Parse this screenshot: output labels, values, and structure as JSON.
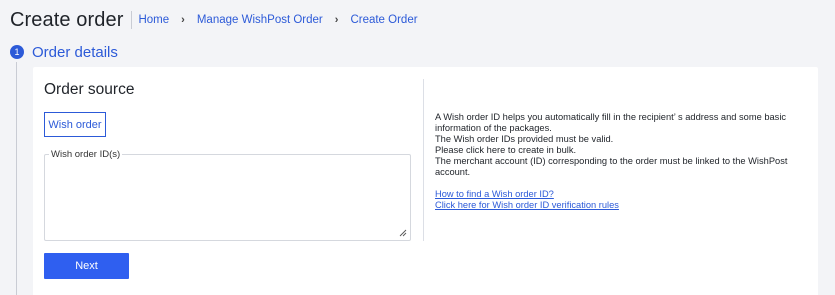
{
  "header": {
    "title": "Create order",
    "breadcrumbs": [
      "Home",
      "Manage WishPost Order",
      "Create Order"
    ]
  },
  "section": {
    "step": "1",
    "title": "Order details"
  },
  "order_source": {
    "title": "Order source",
    "tab_label": "Wish order",
    "field_label": "Wish order ID(s)",
    "field_value": "",
    "next_label": "Next"
  },
  "info": {
    "lines": [
      "A Wish order ID helps you automatically fill in the recipient’ s address and some basic information of the packages.",
      "The Wish order IDs provided must be valid.",
      "Please click here to create in bulk.",
      "The merchant account (ID) corresponding to the order must be linked to the WishPost account."
    ],
    "links": [
      "How to find a Wish order ID?",
      "Click here for Wish order ID verification rules"
    ]
  },
  "colors": {
    "accent": "#2c5ad8",
    "button": "#2f5ff0",
    "background": "#f3f4f7"
  }
}
